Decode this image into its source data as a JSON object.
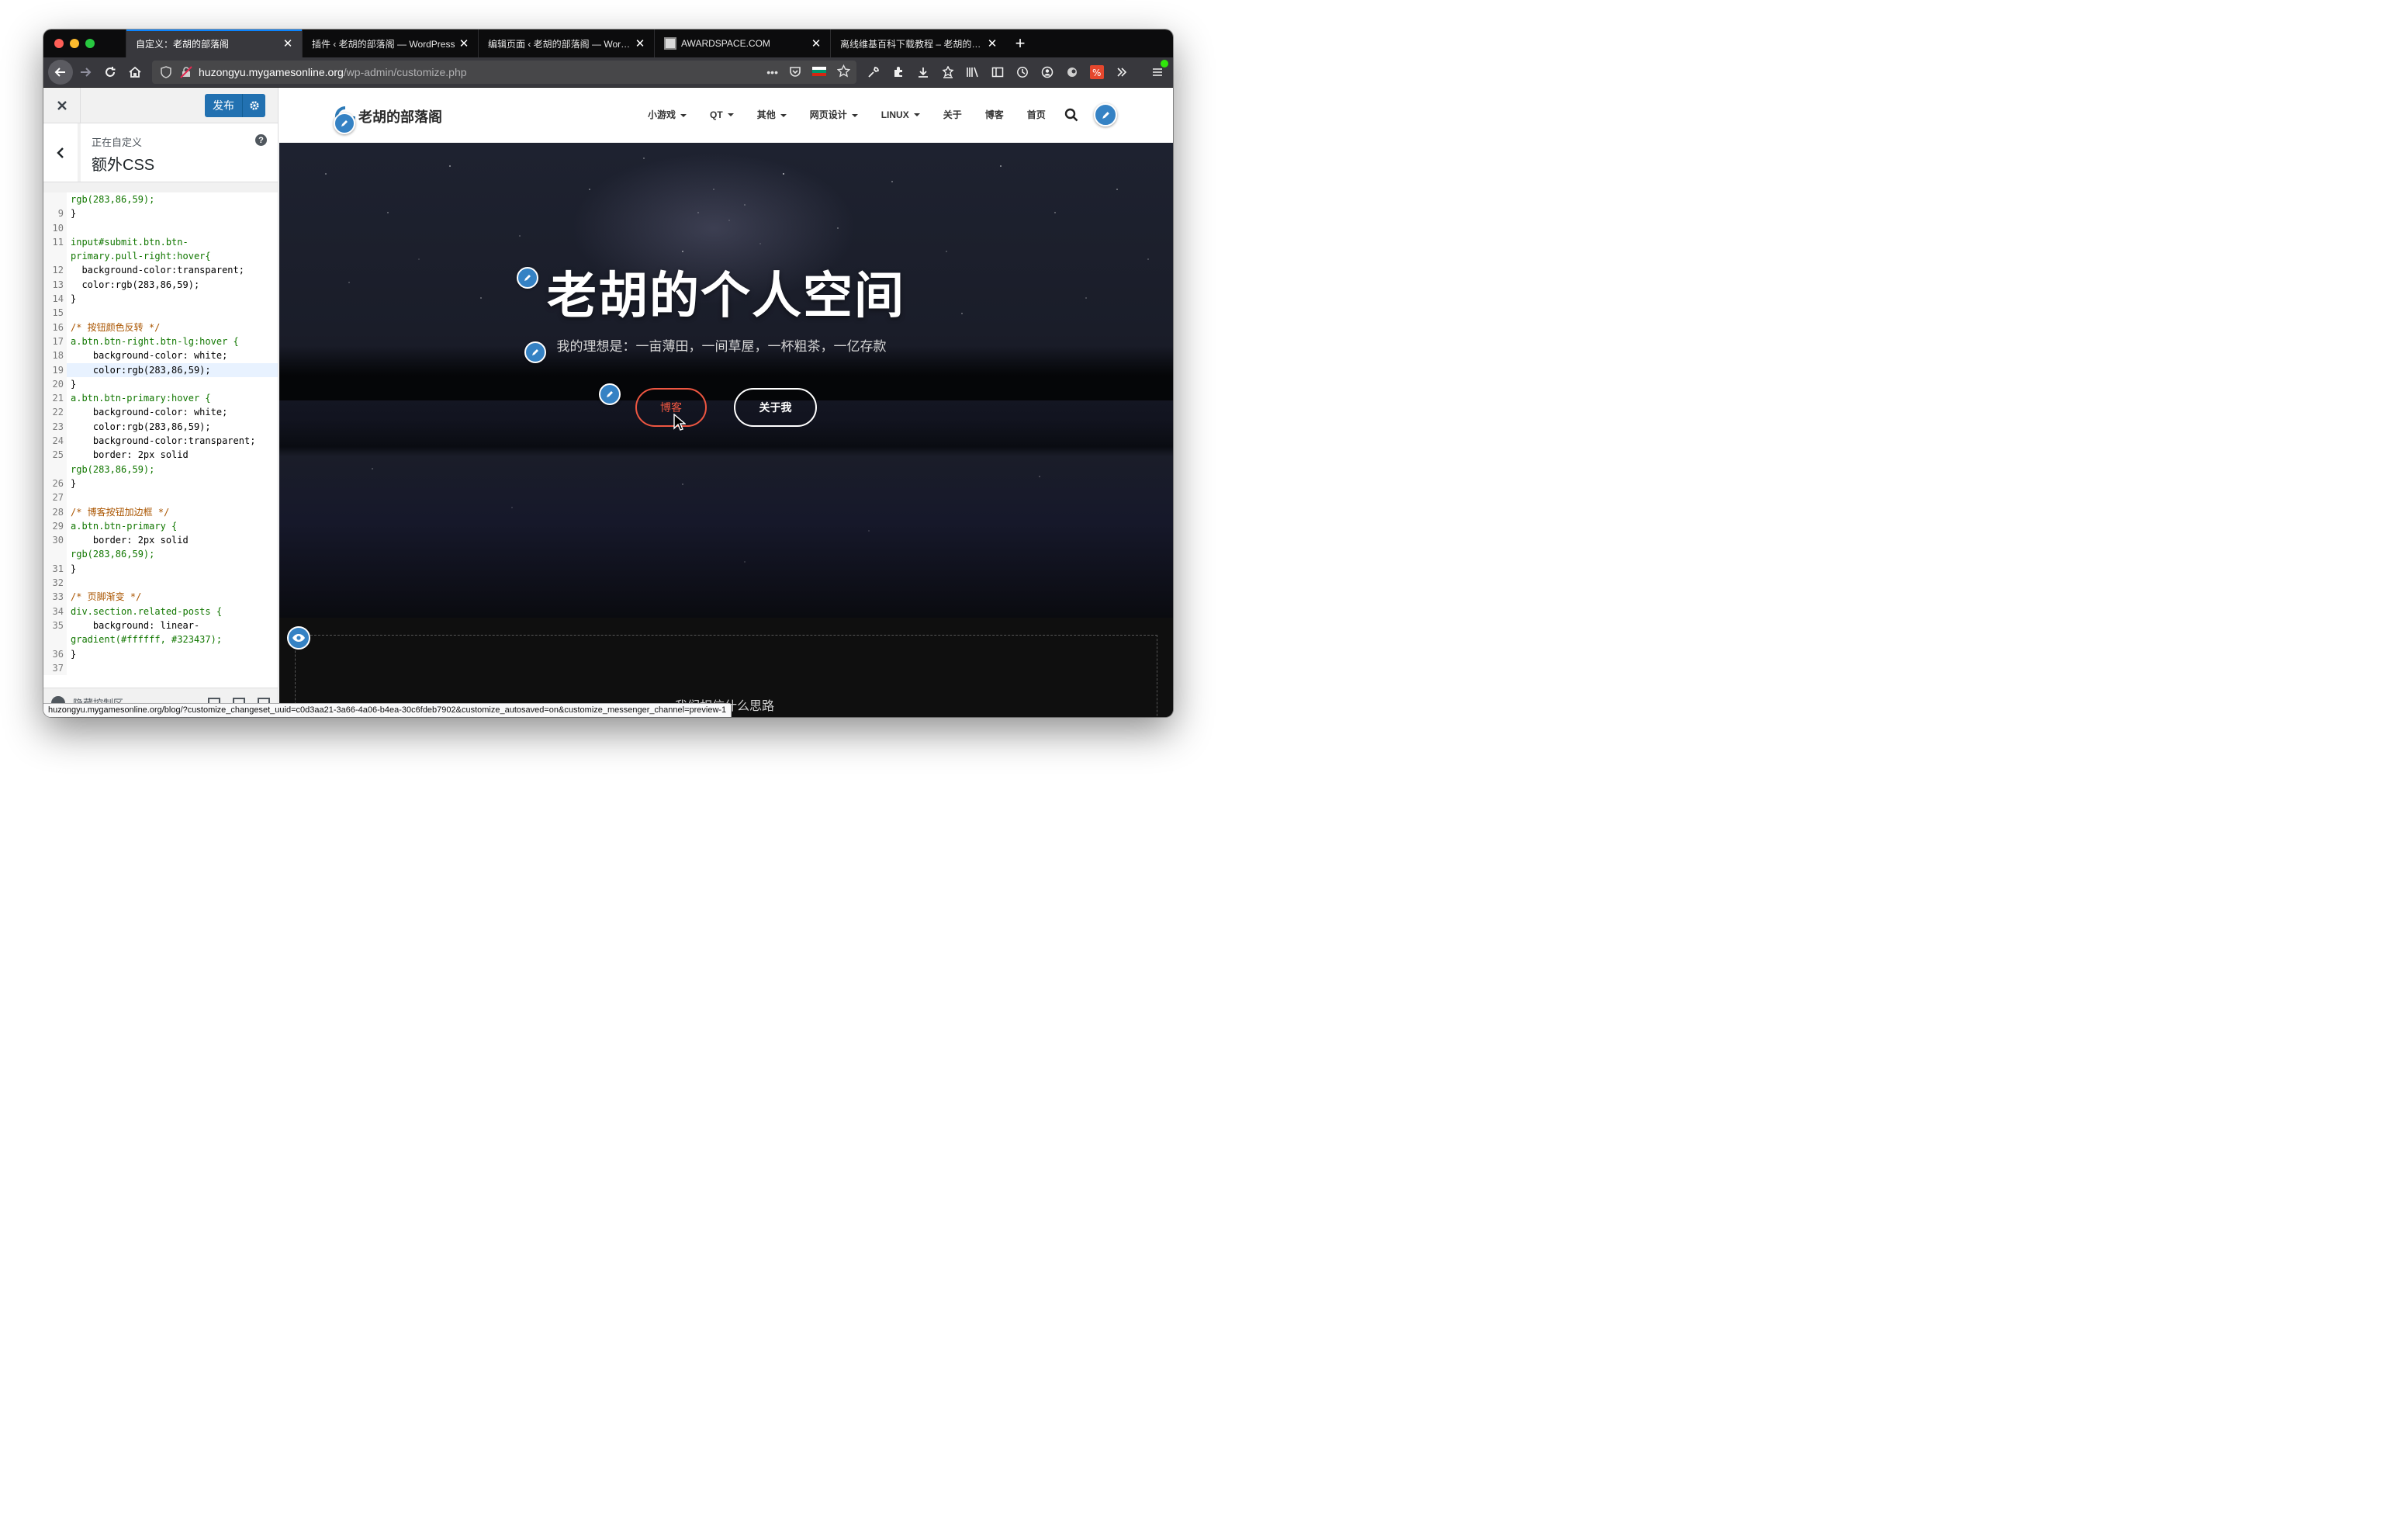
{
  "browser": {
    "tabs": [
      {
        "title": "自定义：老胡的部落阁",
        "active": true
      },
      {
        "title": "插件 ‹ 老胡的部落阁 — WordPress",
        "active": false
      },
      {
        "title": "编辑页面 ‹ 老胡的部落阁 — WordPress",
        "active": false
      },
      {
        "title": "AWARDSPACE.COM",
        "active": false
      },
      {
        "title": "离线维基百科下载教程 – 老胡的部落阁",
        "active": false
      }
    ],
    "url_host": "huzongyu.mygamesonline.org",
    "url_path": "/wp-admin/customize.php",
    "url_more": "•••",
    "status_url": "huzongyu.mygamesonline.org/blog/?customize_changeset_uuid=c0d3aa21-3a66-4a06-b4ea-30c6fdeb7902&customize_autosaved=on&customize_messenger_channel=preview-1"
  },
  "customizer": {
    "publish_label": "发布",
    "section_subtitle": "正在自定义",
    "section_title": "额外CSS",
    "help_label": "?",
    "footer_label": "隐藏控制区",
    "css_lines": [
      {
        "n": "",
        "text": "rgb(283,86,59);"
      },
      {
        "n": "9",
        "text": "}"
      },
      {
        "n": "10",
        "text": ""
      },
      {
        "n": "11",
        "text": "input#submit.btn.btn-"
      },
      {
        "n": "",
        "text": "primary.pull-right:hover{"
      },
      {
        "n": "12",
        "text": "  background-color:transparent;"
      },
      {
        "n": "13",
        "text": "  color:rgb(283,86,59);"
      },
      {
        "n": "14",
        "text": "}"
      },
      {
        "n": "15",
        "text": ""
      },
      {
        "n": "16",
        "text": "/* 按钮颜色反转 */"
      },
      {
        "n": "17",
        "text": "a.btn.btn-right.btn-lg:hover {"
      },
      {
        "n": "18",
        "text": "    background-color: white;"
      },
      {
        "n": "19",
        "text": "    color:rgb(283,86,59);"
      },
      {
        "n": "20",
        "text": "}"
      },
      {
        "n": "21",
        "text": "a.btn.btn-primary:hover {"
      },
      {
        "n": "22",
        "text": "    background-color: white;"
      },
      {
        "n": "23",
        "text": "    color:rgb(283,86,59);"
      },
      {
        "n": "24",
        "text": "    background-color:transparent;"
      },
      {
        "n": "25",
        "text": "    border: 2px solid"
      },
      {
        "n": "",
        "text": "rgb(283,86,59);"
      },
      {
        "n": "26",
        "text": "}"
      },
      {
        "n": "27",
        "text": ""
      },
      {
        "n": "28",
        "text": "/* 博客按钮加边框 */"
      },
      {
        "n": "29",
        "text": "a.btn.btn-primary {"
      },
      {
        "n": "30",
        "text": "    border: 2px solid"
      },
      {
        "n": "",
        "text": "rgb(283,86,59);"
      },
      {
        "n": "31",
        "text": "}"
      },
      {
        "n": "32",
        "text": ""
      },
      {
        "n": "33",
        "text": "/* 页脚渐变 */"
      },
      {
        "n": "34",
        "text": "div.section.related-posts {"
      },
      {
        "n": "35",
        "text": "    background: linear-"
      },
      {
        "n": "",
        "text": "gradient(#ffffff, #323437);"
      },
      {
        "n": "36",
        "text": "}"
      },
      {
        "n": "37",
        "text": ""
      }
    ],
    "highlighted_line": "19"
  },
  "site": {
    "logo_text": "老胡的部落阁",
    "nav": [
      {
        "label": "小游戏",
        "dropdown": true
      },
      {
        "label": "QT",
        "dropdown": true
      },
      {
        "label": "其他",
        "dropdown": true
      },
      {
        "label": "网页设计",
        "dropdown": true
      },
      {
        "label": "LINUX",
        "dropdown": true
      },
      {
        "label": "关于",
        "dropdown": false
      },
      {
        "label": "博客",
        "dropdown": false
      },
      {
        "label": "首页",
        "dropdown": false
      }
    ],
    "hero_title": "老胡的个人空间",
    "hero_subtitle": "我的理想是：一亩薄田，一间草屋，一杯粗茶，一亿存款",
    "btn_blog": "博客",
    "btn_about": "关于我",
    "lower_heading": "我们相信什么思路"
  },
  "colors": {
    "accent_blue": "#2271b1",
    "edit_blue": "#3582c4",
    "brand_red": "#ed5641",
    "tab_highlight": "#0a84ff"
  },
  "icons": {
    "close": "close-icon",
    "back": "chevron-left-icon",
    "gear": "gear-icon",
    "pencil": "pencil-icon",
    "search": "search-icon",
    "eye": "eye-icon"
  }
}
